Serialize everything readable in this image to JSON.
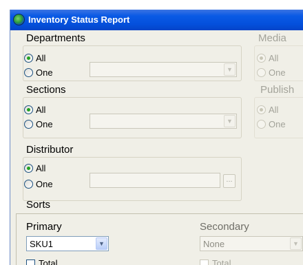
{
  "window": {
    "title": "Inventory Status Report"
  },
  "departments": {
    "label": "Departments",
    "options": [
      "All",
      "One"
    ],
    "selected": "All"
  },
  "sections": {
    "label": "Sections",
    "options": [
      "All",
      "One"
    ],
    "selected": "All"
  },
  "distributor": {
    "label": "Distributor",
    "options": [
      "All",
      "One"
    ],
    "selected": "All",
    "browse_label": "..."
  },
  "media": {
    "label": "Media",
    "options": [
      "All",
      "One"
    ],
    "selected": "All"
  },
  "publisher": {
    "label": "Publish",
    "options": [
      "All",
      "One"
    ],
    "selected": "All"
  },
  "sorts": {
    "label": "Sorts",
    "primary": {
      "label": "Primary",
      "value": "SKU1",
      "total_label": "Total"
    },
    "secondary": {
      "label": "Secondary",
      "value": "None",
      "total_label": "Total"
    }
  },
  "colors": {
    "titlebar": "#0450dc",
    "window_bg": "#f0efe7",
    "radio_checked": "#21a121",
    "disabled_text": "#a3a39a"
  }
}
